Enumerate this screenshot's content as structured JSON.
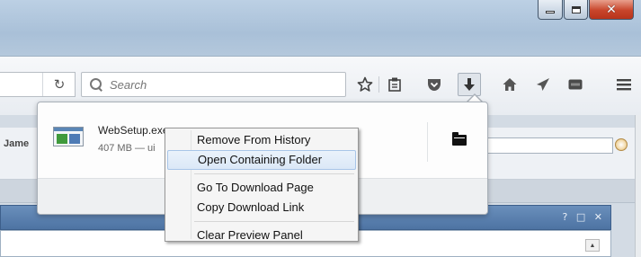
{
  "window": {
    "controls": {
      "minimize": "minimize",
      "maximize": "maximize",
      "close": "✕"
    }
  },
  "toolbar": {
    "reload_glyph": "↻",
    "search_placeholder": "Search",
    "icons": [
      "star-icon",
      "reading-list-icon",
      "pocket-icon",
      "download-icon",
      "home-icon",
      "send-icon",
      "extension-icon",
      "menu-icon"
    ]
  },
  "page": {
    "label": "Jame",
    "panel_controls": "? □ ✕"
  },
  "downloads": {
    "file_name": "WebSetup.exe",
    "file_status": "407 MB — ui"
  },
  "context_menu": {
    "items": [
      {
        "label": "Remove From History",
        "mnemonic": "e"
      },
      {
        "label": "Open Containing Folder",
        "mnemonic": "F",
        "highlighted": true
      },
      {
        "label": "Go To Download Page",
        "mnemonic": "G"
      },
      {
        "label": "Copy Download Link",
        "mnemonic": "L"
      },
      {
        "label": "Clear Preview Panel",
        "mnemonic": "a"
      }
    ]
  },
  "colors": {
    "titlebar": "#b4c8dc",
    "close_button": "#c8452b",
    "menu_highlight": "#dbe8f7"
  }
}
